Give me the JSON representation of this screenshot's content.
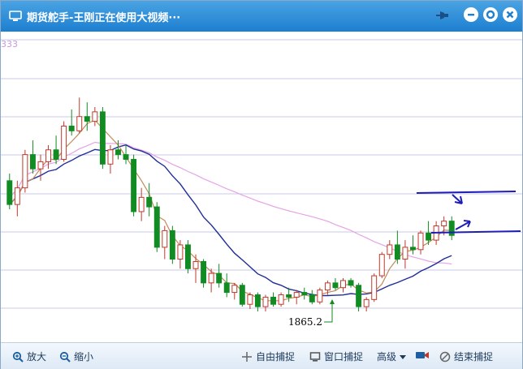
{
  "window": {
    "title": "期货舵手-王刚正在使用大视频···"
  },
  "chart": {
    "price_label_top": "333",
    "low_annotation": "1865.2",
    "colors": {
      "up": "#c0392b",
      "down": "#118c22",
      "ma_short": "#c08a5a",
      "ma_mid": "#1f2d9a",
      "ma_long": "#e6a3e6",
      "grid": "#c9c9e6",
      "annotation": "#1d1db8"
    }
  },
  "toolbar": {
    "zoom_in": "放大",
    "zoom_out": "缩小",
    "free_capture": "自由捕捉",
    "window_capture": "窗口捕捉",
    "advanced": "高级",
    "end_capture": "结束捕捉"
  },
  "chart_data": {
    "type": "candlestick",
    "annotation_low": 1865.2,
    "candles_ohlc_relative": [
      [
        0.55,
        0.58,
        0.43,
        0.45
      ],
      [
        0.45,
        0.55,
        0.4,
        0.52
      ],
      [
        0.52,
        0.68,
        0.5,
        0.66
      ],
      [
        0.66,
        0.72,
        0.58,
        0.6
      ],
      [
        0.6,
        0.66,
        0.55,
        0.63
      ],
      [
        0.63,
        0.7,
        0.6,
        0.68
      ],
      [
        0.68,
        0.74,
        0.62,
        0.64
      ],
      [
        0.64,
        0.8,
        0.63,
        0.78
      ],
      [
        0.78,
        0.85,
        0.74,
        0.76
      ],
      [
        0.76,
        0.9,
        0.75,
        0.82
      ],
      [
        0.82,
        0.88,
        0.76,
        0.8
      ],
      [
        0.8,
        0.86,
        0.78,
        0.84
      ],
      [
        0.84,
        0.86,
        0.6,
        0.62
      ],
      [
        0.62,
        0.7,
        0.58,
        0.68
      ],
      [
        0.68,
        0.72,
        0.64,
        0.66
      ],
      [
        0.66,
        0.7,
        0.62,
        0.64
      ],
      [
        0.64,
        0.66,
        0.4,
        0.42
      ],
      [
        0.42,
        0.52,
        0.38,
        0.48
      ],
      [
        0.48,
        0.54,
        0.4,
        0.44
      ],
      [
        0.44,
        0.46,
        0.25,
        0.27
      ],
      [
        0.27,
        0.36,
        0.22,
        0.34
      ],
      [
        0.34,
        0.36,
        0.2,
        0.22
      ],
      [
        0.22,
        0.3,
        0.18,
        0.28
      ],
      [
        0.28,
        0.3,
        0.16,
        0.18
      ],
      [
        0.18,
        0.24,
        0.12,
        0.21
      ],
      [
        0.21,
        0.22,
        0.1,
        0.12
      ],
      [
        0.12,
        0.18,
        0.08,
        0.16
      ],
      [
        0.16,
        0.2,
        0.1,
        0.12
      ],
      [
        0.12,
        0.16,
        0.06,
        0.08
      ],
      [
        0.08,
        0.12,
        0.05,
        0.11
      ],
      [
        0.11,
        0.12,
        0.02,
        0.03
      ],
      [
        0.03,
        0.08,
        0.01,
        0.07
      ],
      [
        0.07,
        0.08,
        0.0,
        0.02
      ],
      [
        0.02,
        0.07,
        0.0,
        0.06
      ],
      [
        0.06,
        0.08,
        0.02,
        0.03
      ],
      [
        0.03,
        0.08,
        0.02,
        0.07
      ],
      [
        0.07,
        0.1,
        0.04,
        0.06
      ],
      [
        0.06,
        0.09,
        0.03,
        0.08
      ],
      [
        0.08,
        0.1,
        0.05,
        0.07
      ],
      [
        0.07,
        0.09,
        0.03,
        0.04
      ],
      [
        0.04,
        0.1,
        0.03,
        0.09
      ],
      [
        0.09,
        0.13,
        0.07,
        0.12
      ],
      [
        0.12,
        0.14,
        0.09,
        0.1
      ],
      [
        0.1,
        0.14,
        0.08,
        0.13
      ],
      [
        0.13,
        0.14,
        0.1,
        0.11
      ],
      [
        0.11,
        0.12,
        0.0,
        0.02
      ],
      [
        0.02,
        0.06,
        0.0,
        0.05
      ],
      [
        0.05,
        0.16,
        0.04,
        0.15
      ],
      [
        0.15,
        0.25,
        0.14,
        0.24
      ],
      [
        0.24,
        0.3,
        0.22,
        0.28
      ],
      [
        0.28,
        0.34,
        0.2,
        0.22
      ],
      [
        0.22,
        0.3,
        0.18,
        0.27
      ],
      [
        0.27,
        0.32,
        0.24,
        0.26
      ],
      [
        0.26,
        0.34,
        0.24,
        0.33
      ],
      [
        0.33,
        0.38,
        0.28,
        0.3
      ],
      [
        0.3,
        0.38,
        0.28,
        0.36
      ],
      [
        0.36,
        0.4,
        0.32,
        0.38
      ],
      [
        0.38,
        0.4,
        0.3,
        0.32
      ]
    ]
  }
}
